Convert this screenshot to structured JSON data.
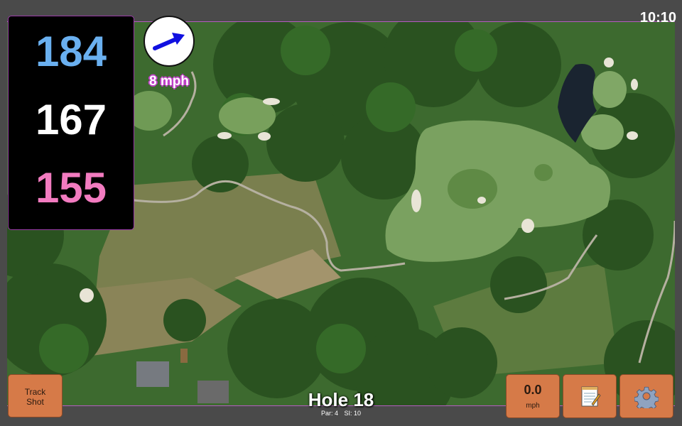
{
  "status": {
    "time": "10:10"
  },
  "distances": {
    "back": "184",
    "middle": "167",
    "front": "155",
    "back_color": "#6ab0f0",
    "front_color": "#f27bc0"
  },
  "wind": {
    "speed": "8 mph",
    "arrow_color": "#1010e0"
  },
  "buttons": {
    "track_shot_line1": "Track",
    "track_shot_line2": "Shot",
    "speed_value": "0.0",
    "speed_unit": "mph",
    "notes_icon": "notepad-icon",
    "settings_icon": "gear-icon",
    "color": "#d67a48"
  },
  "hole": {
    "title": "Hole 18",
    "par": "Par: 4",
    "si": "SI: 10"
  }
}
